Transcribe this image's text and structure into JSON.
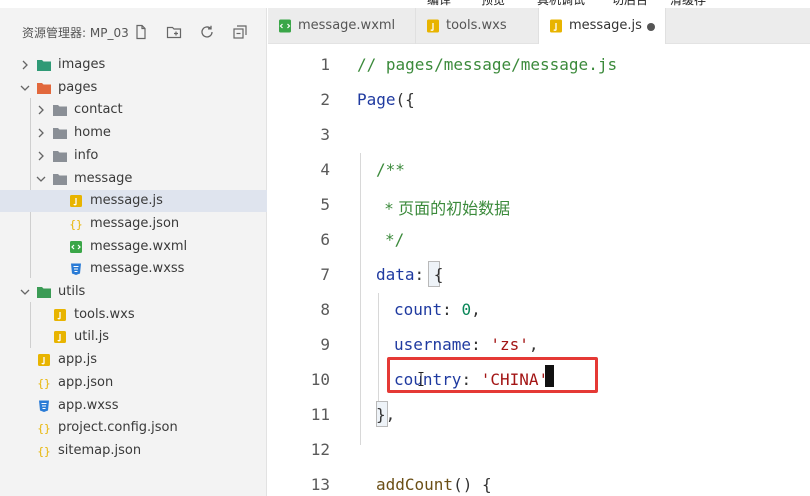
{
  "menubar": {
    "items": [
      "编译",
      "预览",
      "真机调试",
      "切后台",
      "清缓存"
    ]
  },
  "explorer": {
    "title": "资源管理器: MP_03",
    "header_buttons": [
      "new-file-icon",
      "new-folder-icon",
      "refresh-icon",
      "collapse-all-icon"
    ],
    "tree": [
      {
        "label": "images",
        "type": "folder",
        "expanded": false,
        "depth": 0
      },
      {
        "label": "pages",
        "type": "folder",
        "expanded": true,
        "depth": 0
      },
      {
        "label": "contact",
        "type": "folder",
        "expanded": false,
        "depth": 1
      },
      {
        "label": "home",
        "type": "folder",
        "expanded": false,
        "depth": 1
      },
      {
        "label": "info",
        "type": "folder",
        "expanded": false,
        "depth": 1
      },
      {
        "label": "message",
        "type": "folder",
        "expanded": true,
        "depth": 1
      },
      {
        "label": "message.js",
        "type": "js",
        "depth": 2,
        "selected": true
      },
      {
        "label": "message.json",
        "type": "json",
        "depth": 2
      },
      {
        "label": "message.wxml",
        "type": "wxml",
        "depth": 2
      },
      {
        "label": "message.wxss",
        "type": "wxss",
        "depth": 2
      },
      {
        "label": "utils",
        "type": "folder",
        "expanded": true,
        "depth": 0
      },
      {
        "label": "tools.wxs",
        "type": "js",
        "depth": 1
      },
      {
        "label": "util.js",
        "type": "js",
        "depth": 1
      },
      {
        "label": "app.js",
        "type": "js",
        "depth": 0
      },
      {
        "label": "app.json",
        "type": "json",
        "depth": 0
      },
      {
        "label": "app.wxss",
        "type": "wxss",
        "depth": 0
      },
      {
        "label": "project.config.json",
        "type": "json",
        "depth": 0
      },
      {
        "label": "sitemap.json",
        "type": "json",
        "depth": 0
      }
    ]
  },
  "tabs": [
    {
      "label": "message.wxml",
      "icon": "wxml-file-icon",
      "active": false
    },
    {
      "label": "tools.wxs",
      "icon": "js-file-icon",
      "active": false
    },
    {
      "label": "message.js",
      "icon": "js-file-icon",
      "active": true,
      "dirty": true
    }
  ],
  "editor": {
    "lines": [
      {
        "num": "1",
        "text": "// pages/message/message.js"
      },
      {
        "num": "2",
        "text": "Page({"
      },
      {
        "num": "3",
        "text": ""
      },
      {
        "num": "4",
        "text": "/**"
      },
      {
        "num": "5",
        "text": "* 页面的初始数据"
      },
      {
        "num": "6",
        "text": "*/"
      },
      {
        "num": "7",
        "text": "data: {"
      },
      {
        "num": "8",
        "text": "count: 0,"
      },
      {
        "num": "9",
        "text": "username: 'zs',"
      },
      {
        "num": "10",
        "text": "country: 'CHINA'"
      },
      {
        "num": "11",
        "text": "},"
      },
      {
        "num": "12",
        "text": ""
      },
      {
        "num": "13",
        "text": "addCount() {"
      }
    ],
    "highlighted_line": "10"
  },
  "colors": {
    "folder": "#8a8f96",
    "js": "#e8b400",
    "json": "#e8b400",
    "wxml": "#3aa648",
    "wxss": "#2a7bd6",
    "images_folder": "#2f9a76",
    "pages_folder": "#e2683c",
    "utils_folder": "#3b9b55",
    "highlight_box": "#e53935"
  }
}
